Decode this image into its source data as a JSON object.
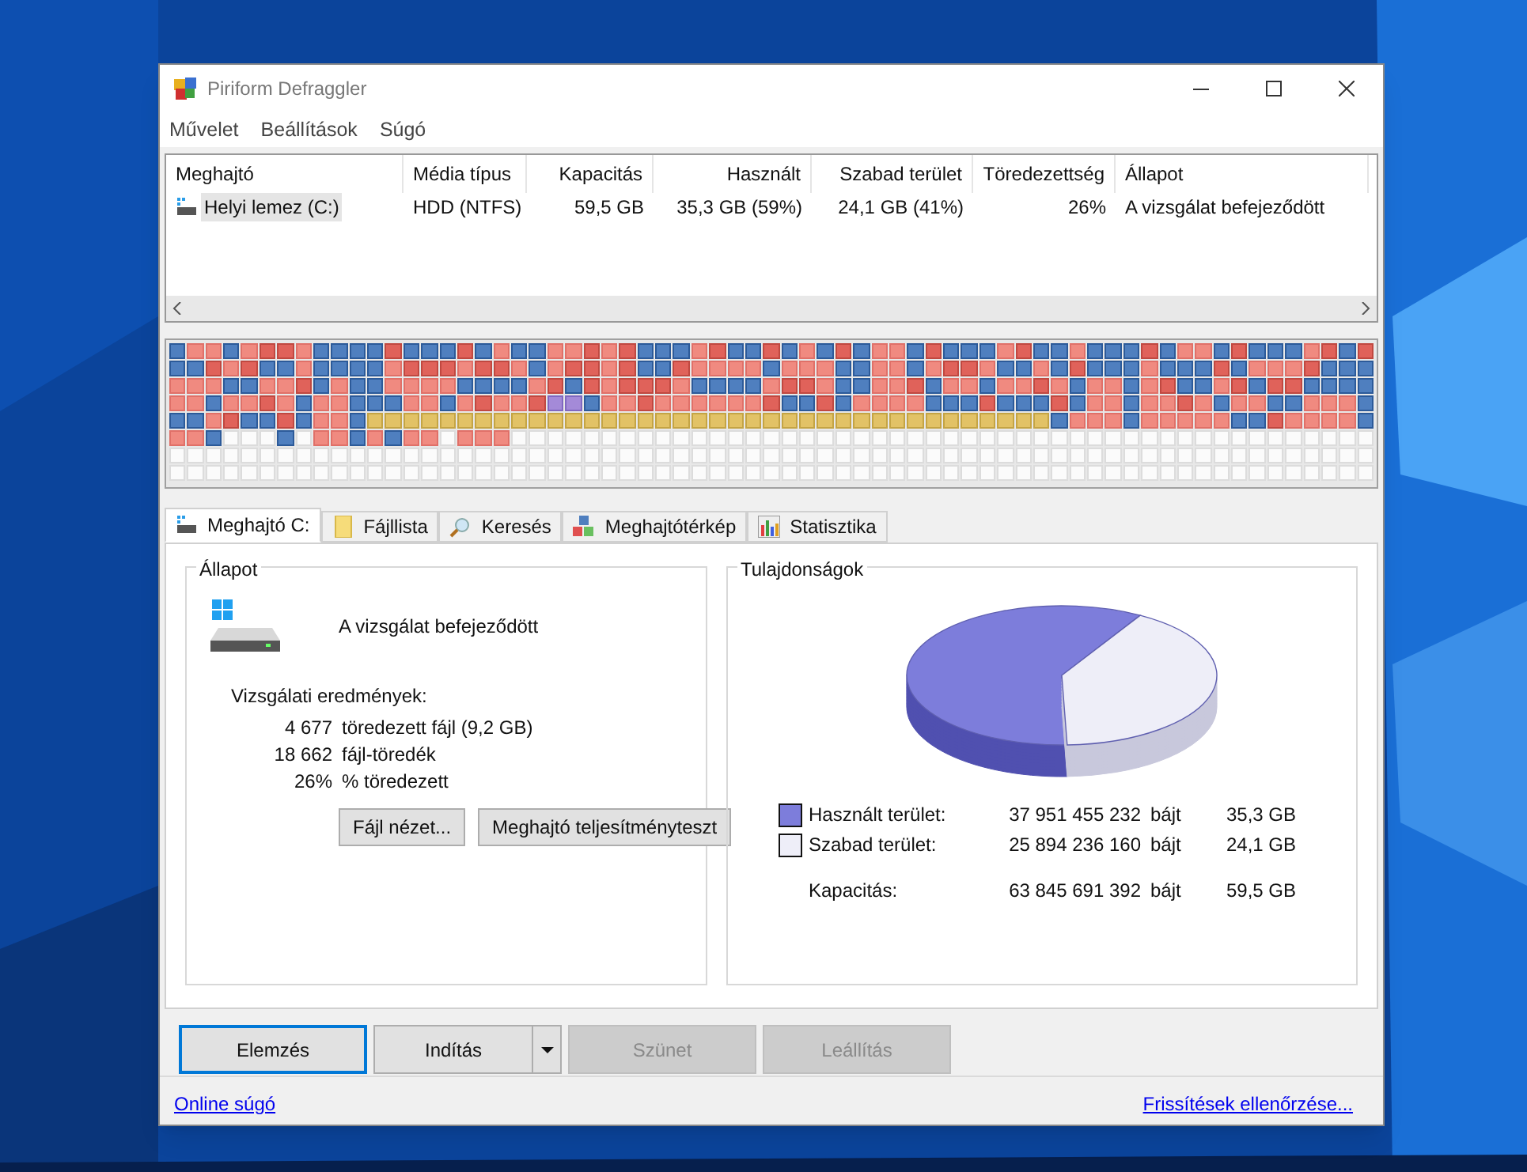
{
  "window": {
    "title": "Piriform Defraggler"
  },
  "menu": [
    "Művelet",
    "Beállítások",
    "Súgó"
  ],
  "drive_list": {
    "columns": [
      "Meghajtó",
      "Média típus",
      "Kapacitás",
      "Használt",
      "Szabad terület",
      "Töredezettség",
      "Állapot"
    ],
    "rows": [
      {
        "selected": true,
        "cells": [
          "Helyi lemez (C:)",
          "HDD (NTFS)",
          "59,5 GB",
          "35,3 GB (59%)",
          "24,1 GB (41%)",
          "26%",
          "A vizsgálat befejeződött"
        ]
      }
    ]
  },
  "tabs": [
    {
      "label": "Meghajtó C:",
      "selected": true
    },
    {
      "label": "Fájllista",
      "selected": false
    },
    {
      "label": "Keresés",
      "selected": false
    },
    {
      "label": "Meghajtótérkép",
      "selected": false
    },
    {
      "label": "Statisztika",
      "selected": false
    }
  ],
  "status_group": {
    "title": "Állapot",
    "message": "A vizsgálat befejeződött",
    "results_title": "Vizsgálati eredmények:",
    "results": [
      {
        "count": "4 677",
        "description": "töredezett fájl (9,2 GB)"
      },
      {
        "count": "18 662",
        "description": "fájl-töredék"
      },
      {
        "count": "26%",
        "description": "% töredezett"
      }
    ],
    "buttons": [
      "Fájl nézet...",
      "Meghajtó teljesítményteszt"
    ]
  },
  "properties_group": {
    "title": "Tulajdonságok",
    "legend": [
      {
        "label": "Használt terület:",
        "bytes": "37 951 455 232",
        "unit": "bájt",
        "size": "35,3 GB",
        "color": "#7d7ddb"
      },
      {
        "label": "Szabad terület:",
        "bytes": "25 894 236 160",
        "unit": "bájt",
        "size": "24,1 GB",
        "color": "#eeeef8"
      }
    ],
    "total": {
      "label": "Kapacitás:",
      "bytes": "63 845 691 392",
      "unit": "bájt",
      "size": "59,5 GB"
    }
  },
  "actions": [
    {
      "label": "Elemzés",
      "focused": true,
      "disabled": false,
      "dropdown": false
    },
    {
      "label": "Indítás",
      "focused": false,
      "disabled": false,
      "dropdown": true
    },
    {
      "label": "Szünet",
      "focused": false,
      "disabled": true,
      "dropdown": false
    },
    {
      "label": "Leállítás",
      "focused": false,
      "disabled": true,
      "dropdown": false
    }
  ],
  "status_bar": {
    "left_link": "Online súgó",
    "right_link": "Frissítések ellenőrzése..."
  }
}
